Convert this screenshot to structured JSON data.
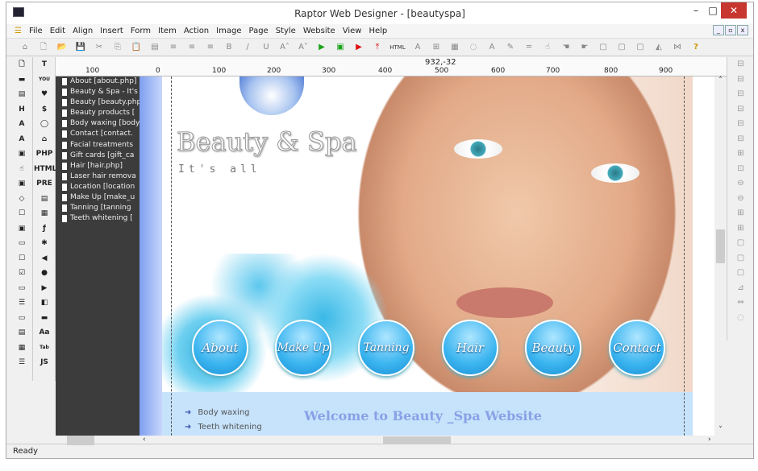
{
  "window": {
    "title": "Raptor Web Designer - [beautyspa]",
    "controls": [
      "–",
      "□",
      "✕"
    ]
  },
  "menu": [
    "File",
    "Edit",
    "Align",
    "Insert",
    "Form",
    "Item",
    "Action",
    "Image",
    "Page",
    "Style",
    "Website",
    "View",
    "Help"
  ],
  "toolbar": [
    "⌂",
    "🗋",
    "📂",
    "💾",
    "✂",
    "⎘",
    "📋",
    "▤",
    "≡",
    "≡",
    "≡",
    "B",
    "/",
    "U",
    "A˄",
    "A˅",
    "▶",
    "▣",
    "▶",
    "⤒",
    "HTML",
    "A",
    "⊞",
    "▦",
    "◌",
    "A",
    "✎",
    "═",
    "☝",
    "☚",
    "☛",
    "▢",
    "▢",
    "▢",
    "◭",
    "⋈",
    "?"
  ],
  "toolbar_colors": {
    "play": "#1aa31a",
    "stop": "#e01010"
  },
  "left_tools_1": [
    "🗋",
    "▬",
    "▤",
    "H",
    "A",
    "A",
    "▣",
    "☝",
    "▣",
    "◇",
    "☐",
    "▣",
    "▭",
    "☐",
    "☑",
    "▭",
    "☰",
    "▭",
    "▤",
    "▦",
    "☰"
  ],
  "left_tools_2": [
    "T",
    "YOU",
    "♥",
    "$",
    "◯",
    "⌂",
    "PHP",
    "HTML",
    "PRE",
    "▤",
    "▦",
    "ƒ",
    "✱",
    "◀",
    "●",
    "▶",
    "◧",
    "▬",
    "Aa",
    "Tab",
    "JS"
  ],
  "right_tools": [
    "⊟",
    "⊟",
    "⊟",
    "⊟",
    "⊟",
    "⊟",
    "⊞",
    "⊡",
    "⊖",
    "⊖",
    "⊞",
    "⊞",
    "▢",
    "▢",
    "▢",
    "⊿",
    "⇔",
    "◌"
  ],
  "ruler": {
    "coord": "932,-32",
    "labels": [
      "100",
      "0",
      "100",
      "200",
      "300",
      "400",
      "500",
      "600",
      "700",
      "800",
      "900"
    ]
  },
  "tree": [
    "About [about.php]",
    "Beauty & Spa - It's all",
    "Beauty [beauty.php]",
    "Beauty products [",
    "Body waxing [body",
    "Contact [contact.",
    "Facial treatments",
    "Gift cards [gift_ca",
    "Hair [hair.php]",
    "Laser hair remova",
    "Location [location",
    "Make Up [make_u",
    "Tanning [tanning",
    "Teeth whitening ["
  ],
  "page": {
    "brand": "Beauty & Spa",
    "tagline": "It's all",
    "nav": [
      "About",
      "Make Up",
      "Tanning",
      "Hair",
      "Beauty",
      "Contact"
    ],
    "links": [
      "Body waxing",
      "Teeth whitening"
    ],
    "welcome": "Welcome to Beauty _Spa Website"
  },
  "status": "Ready"
}
